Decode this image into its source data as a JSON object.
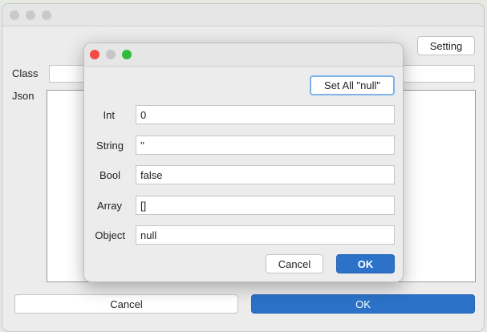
{
  "main_window": {
    "setting_label": "Setting",
    "class_label": "Class",
    "class_value": "",
    "json_label": "Json",
    "json_value": "",
    "cancel_label": "Cancel",
    "ok_label": "OK"
  },
  "dialog": {
    "set_all_label": "Set All \"null\"",
    "fields": [
      {
        "label": "Int",
        "value": "0"
      },
      {
        "label": "String",
        "value": "''"
      },
      {
        "label": "Bool",
        "value": "false"
      },
      {
        "label": "Array",
        "value": "[]"
      },
      {
        "label": "Object",
        "value": "null"
      }
    ],
    "cancel_label": "Cancel",
    "ok_label": "OK"
  },
  "colors": {
    "accent": "#2b72c8",
    "close": "#f44b45",
    "minimize": "#c6c6c6",
    "zoom": "#2fbb3c"
  }
}
